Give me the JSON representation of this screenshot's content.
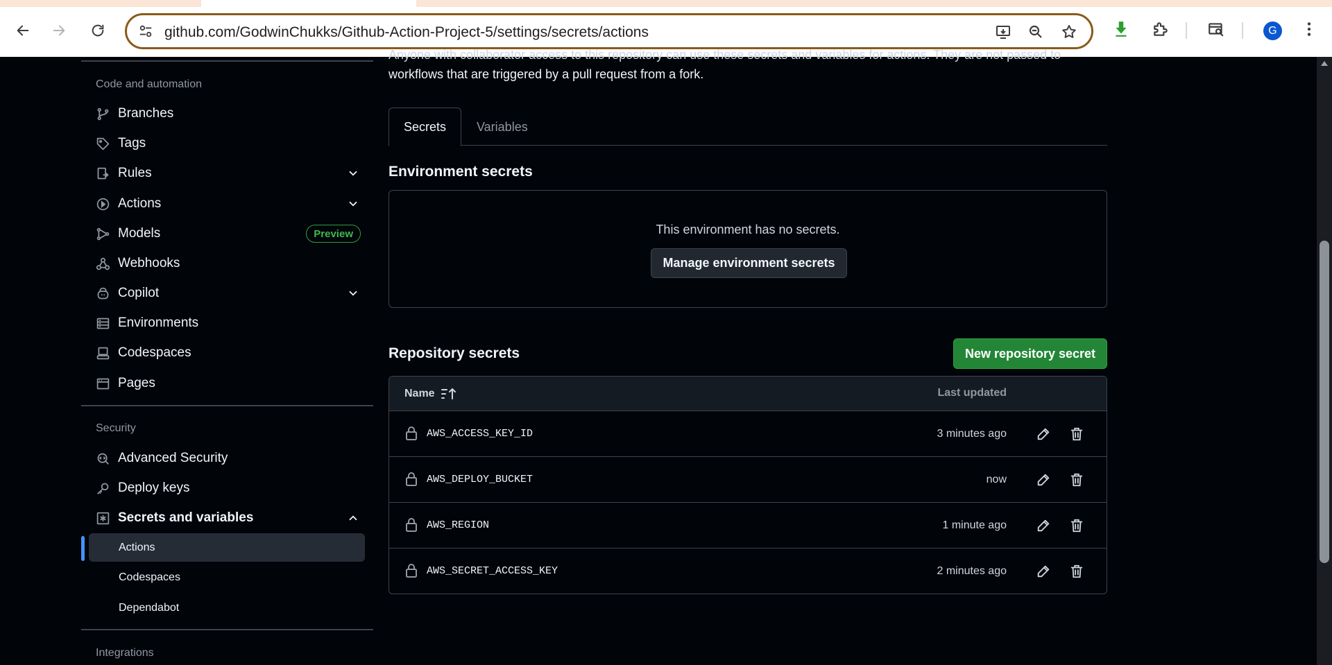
{
  "browser": {
    "url": "github.com/GodwinChukks/Github-Action-Project-5/settings/secrets/actions",
    "profile_initial": "G",
    "nav_icons": [
      "back-icon",
      "forward-icon",
      "reload-icon"
    ],
    "omnibox_icons": [
      "install-app-icon",
      "zoom-out-icon",
      "bookmark-star-icon"
    ],
    "extension_icons": [
      "download-extension-icon",
      "puzzle-extensions-icon",
      "tab-search-icon",
      "more-menu-icon"
    ]
  },
  "sidebar": {
    "code_automation_heading": "Code and automation",
    "items": [
      {
        "label": "Branches",
        "icon": "git-branch-icon"
      },
      {
        "label": "Tags",
        "icon": "tag-icon"
      },
      {
        "label": "Rules",
        "icon": "rules-icon",
        "expandable": true
      },
      {
        "label": "Actions",
        "icon": "play-icon",
        "expandable": true
      },
      {
        "label": "Models",
        "icon": "models-icon",
        "badge": "Preview"
      },
      {
        "label": "Webhooks",
        "icon": "webhook-icon"
      },
      {
        "label": "Copilot",
        "icon": "copilot-icon",
        "expandable": true
      },
      {
        "label": "Environments",
        "icon": "server-icon"
      },
      {
        "label": "Codespaces",
        "icon": "codespaces-icon"
      },
      {
        "label": "Pages",
        "icon": "browser-icon"
      }
    ],
    "security_heading": "Security",
    "security_items": [
      {
        "label": "Advanced Security",
        "icon": "codescan-icon"
      },
      {
        "label": "Deploy keys",
        "icon": "key-icon"
      },
      {
        "label": "Secrets and variables",
        "icon": "asterisk-icon",
        "expanded": true
      }
    ],
    "secrets_subitems": [
      {
        "label": "Actions",
        "active": true
      },
      {
        "label": "Codespaces"
      },
      {
        "label": "Dependabot"
      }
    ],
    "integrations_heading": "Integrations",
    "models_badge": "Preview"
  },
  "main": {
    "intro_line1": "Anyone with collaborator access to this repository can use these secrets and variables for actions. They are not passed to",
    "intro_line2": "workflows that are triggered by a pull request from a fork.",
    "tabs": [
      {
        "label": "Secrets",
        "active": true
      },
      {
        "label": "Variables"
      }
    ],
    "environment_secrets": {
      "title": "Environment secrets",
      "empty_message": "This environment has no secrets.",
      "manage_button": "Manage environment secrets"
    },
    "repository_secrets": {
      "title": "Repository secrets",
      "new_button": "New repository secret",
      "columns": {
        "name": "Name",
        "last_updated": "Last updated"
      },
      "rows": [
        {
          "name": "AWS_ACCESS_KEY_ID",
          "updated": "3 minutes ago"
        },
        {
          "name": "AWS_DEPLOY_BUCKET",
          "updated": "now"
        },
        {
          "name": "AWS_REGION",
          "updated": "1 minute ago"
        },
        {
          "name": "AWS_SECRET_ACCESS_KEY",
          "updated": "2 minutes ago"
        }
      ]
    }
  },
  "colors": {
    "background": "#010409",
    "accent_blue": "#4493f8",
    "button_green": "#238636",
    "border": "#3d444d",
    "omnibox_border": "#8a5a1a"
  }
}
